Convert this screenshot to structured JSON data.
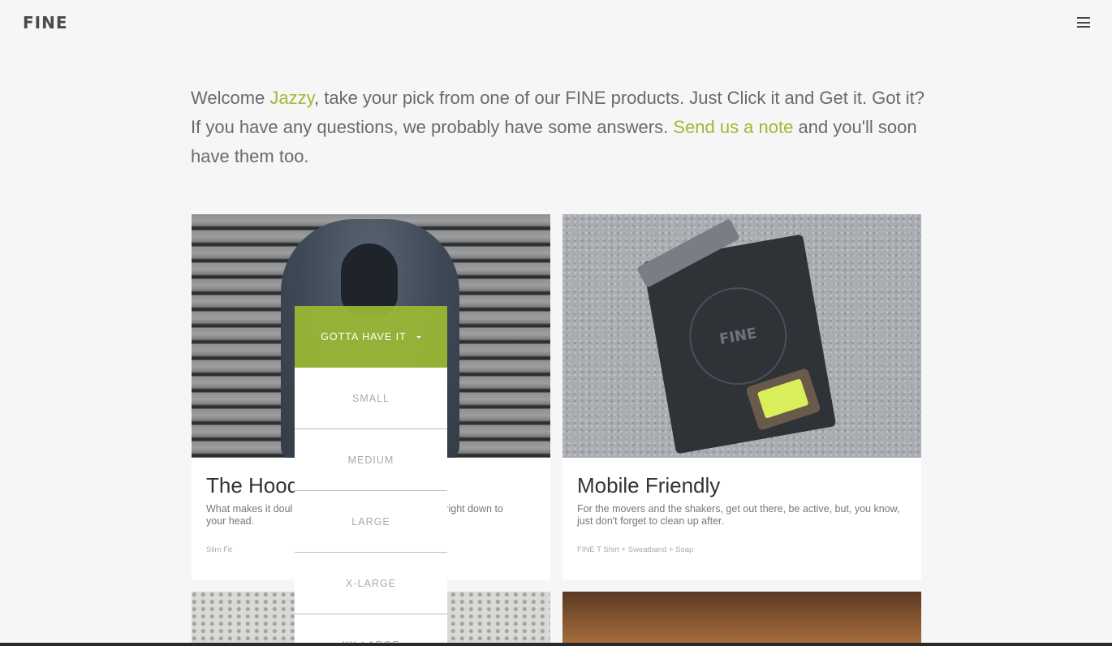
{
  "header": {
    "logo": "FINE",
    "menu_icon": "hamburger-menu-icon"
  },
  "intro": {
    "part1": "Welcome ",
    "name_link": "Jazzy",
    "part2": ", take your pick from one of our FINE products. Just Click it and Get it. Got it? If you have any questions, we probably have some answers. ",
    "note_link": "Send us a note",
    "part3": " and you'll soon have them too."
  },
  "colors": {
    "accent": "#9bbb34",
    "background": "#f6f6f6"
  },
  "products": [
    {
      "title": "The Hood",
      "desc_left": "What makes it doul",
      "desc_right": "right down to",
      "desc_line2": "your head.",
      "tag": "Slim Fit"
    },
    {
      "title": "Mobile Friendly",
      "desc": "For the movers and the shakers, get out there, be active, but, you know, just don't forget to clean up after.",
      "tag": "FINE T Shirt + Sweatband + Soap",
      "crest_text": "FINE"
    }
  ],
  "dropdown": {
    "toggle_label": "GOTTA HAVE IT",
    "options": [
      "SMALL",
      "MEDIUM",
      "LARGE",
      "X-LARGE",
      "XX-LARGE"
    ]
  }
}
